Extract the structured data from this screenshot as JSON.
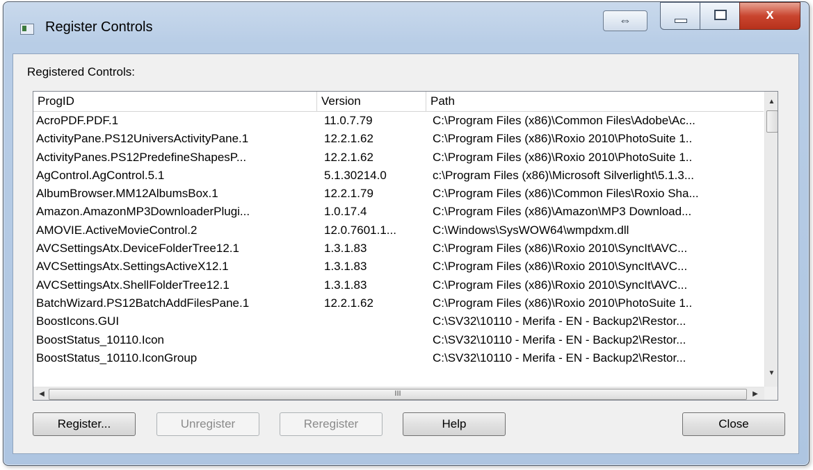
{
  "window": {
    "title": "Register Controls",
    "swap_glyph": "⇔",
    "close_glyph": "x"
  },
  "main": {
    "section_label": "Registered Controls:",
    "columns": [
      "ProgID",
      "Version",
      "Path"
    ],
    "rows": [
      {
        "progid": "AcroPDF.PDF.1",
        "version": "11.0.7.79",
        "path": "C:\\Program Files (x86)\\Common Files\\Adobe\\Ac..."
      },
      {
        "progid": "ActivityPane.PS12UniversActivityPane.1",
        "version": "12.2.1.62",
        "path": "C:\\Program Files (x86)\\Roxio 2010\\PhotoSuite 1.."
      },
      {
        "progid": "ActivityPanes.PS12PredefineShapesP...",
        "version": "12.2.1.62",
        "path": "C:\\Program Files (x86)\\Roxio 2010\\PhotoSuite 1.."
      },
      {
        "progid": "AgControl.AgControl.5.1",
        "version": "5.1.30214.0",
        "path": "c:\\Program Files (x86)\\Microsoft Silverlight\\5.1.3..."
      },
      {
        "progid": "AlbumBrowser.MM12AlbumsBox.1",
        "version": "12.2.1.79",
        "path": "C:\\Program Files (x86)\\Common Files\\Roxio Sha..."
      },
      {
        "progid": "Amazon.AmazonMP3DownloaderPlugi...",
        "version": "1.0.17.4",
        "path": "C:\\Program Files (x86)\\Amazon\\MP3 Download..."
      },
      {
        "progid": "AMOVIE.ActiveMovieControl.2",
        "version": "12.0.7601.1...",
        "path": "C:\\Windows\\SysWOW64\\wmpdxm.dll"
      },
      {
        "progid": "AVCSettingsAtx.DeviceFolderTree12.1",
        "version": "1.3.1.83",
        "path": "C:\\Program Files (x86)\\Roxio 2010\\SyncIt\\AVC..."
      },
      {
        "progid": "AVCSettingsAtx.SettingsActiveX12.1",
        "version": "1.3.1.83",
        "path": "C:\\Program Files (x86)\\Roxio 2010\\SyncIt\\AVC..."
      },
      {
        "progid": "AVCSettingsAtx.ShellFolderTree12.1",
        "version": "1.3.1.83",
        "path": "C:\\Program Files (x86)\\Roxio 2010\\SyncIt\\AVC..."
      },
      {
        "progid": "BatchWizard.PS12BatchAddFilesPane.1",
        "version": "12.2.1.62",
        "path": "C:\\Program Files (x86)\\Roxio 2010\\PhotoSuite 1.."
      },
      {
        "progid": "BoostIcons.GUI",
        "version": "",
        "path": "C:\\SV32\\10110 - Merifa - EN - Backup2\\Restor..."
      },
      {
        "progid": "BoostStatus_10110.Icon",
        "version": "",
        "path": "C:\\SV32\\10110 - Merifa - EN - Backup2\\Restor..."
      },
      {
        "progid": "BoostStatus_10110.IconGroup",
        "version": "",
        "path": "C:\\SV32\\10110 - Merifa - EN - Backup2\\Restor..."
      }
    ],
    "hscroll_grip": "III"
  },
  "buttons": {
    "register": "Register...",
    "unregister": "Unregister",
    "reregister": "Reregister",
    "help": "Help",
    "close": "Close"
  },
  "icons": {
    "app": "window-app-icon",
    "swap": "swap-arrows-icon",
    "minimize": "minimize-icon",
    "maximize": "maximize-icon",
    "close": "close-icon",
    "scroll_up": "chevron-up-icon",
    "scroll_down": "chevron-down-icon",
    "scroll_left": "chevron-left-icon",
    "scroll_right": "chevron-right-icon"
  }
}
